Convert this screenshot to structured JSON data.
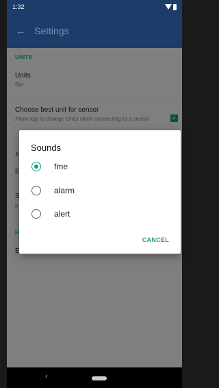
{
  "status_bar": {
    "time": "1:32"
  },
  "app_bar": {
    "title": "Settings"
  },
  "settings": {
    "units_section": "UNITS",
    "units_title": "Units",
    "units_value": "Bar",
    "best_unit_title": "Choose best unit for sensor",
    "best_unit_summary": "Allow app to change Units when connecting to a sensor",
    "best_unit_checked": true,
    "partial_header_a": "A",
    "partial_row_e1": "E",
    "partial_row_s": "S",
    "partial_row_fr": "fr",
    "partial_header_h": "H",
    "partial_row_e2": "E"
  },
  "dialog": {
    "title": "Sounds",
    "options": [
      {
        "label": "fme",
        "selected": true
      },
      {
        "label": "alarm",
        "selected": false
      },
      {
        "label": "alert",
        "selected": false
      }
    ],
    "cancel": "CANCEL"
  },
  "colors": {
    "app_bar": "#1c3c6a",
    "accent": "#1e9b87",
    "scrim_content": "#7f7f7f"
  }
}
